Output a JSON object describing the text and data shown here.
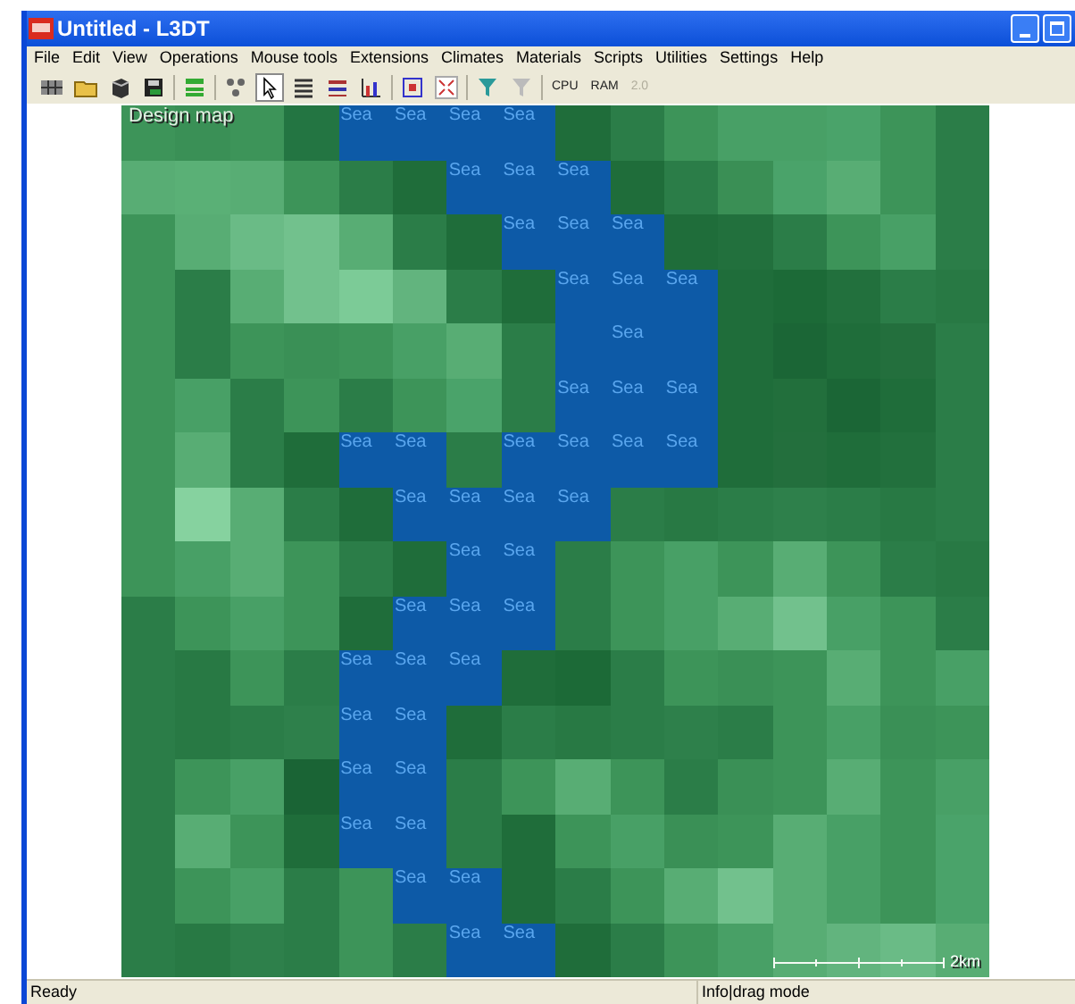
{
  "window": {
    "title": "Untitled - L3DT"
  },
  "menu": [
    {
      "label": "File"
    },
    {
      "label": "Edit"
    },
    {
      "label": "View"
    },
    {
      "label": "Operations"
    },
    {
      "label": "Mouse tools"
    },
    {
      "label": "Extensions"
    },
    {
      "label": "Climates"
    },
    {
      "label": "Materials"
    },
    {
      "label": "Scripts"
    },
    {
      "label": "Utilities"
    },
    {
      "label": "Settings"
    },
    {
      "label": "Help"
    }
  ],
  "toolbar": {
    "pointer_selected": true,
    "text_buttons": [
      {
        "label": "CPU",
        "disabled": false
      },
      {
        "label": "RAM",
        "disabled": false
      },
      {
        "label": "2.0",
        "disabled": true
      }
    ]
  },
  "map": {
    "title": "Design map",
    "scale_label": "2km",
    "rows": [
      [
        {
          "kind": "land",
          "color": "#3d9459"
        },
        {
          "kind": "land",
          "color": "#3a9056"
        },
        {
          "kind": "land",
          "color": "#3d9459"
        },
        {
          "kind": "land",
          "color": "#237542"
        },
        {
          "kind": "sea",
          "label": "Sea"
        },
        {
          "kind": "sea",
          "label": "Sea"
        },
        {
          "kind": "sea",
          "label": "Sea"
        },
        {
          "kind": "sea",
          "label": "Sea"
        },
        {
          "kind": "land",
          "color": "#1f6d3a"
        },
        {
          "kind": "land",
          "color": "#2b7d48"
        },
        {
          "kind": "land",
          "color": "#3d9459"
        },
        {
          "kind": "land",
          "color": "#48a066"
        },
        {
          "kind": "land",
          "color": "#48a066"
        },
        {
          "kind": "land",
          "color": "#4aa36a"
        },
        {
          "kind": "land",
          "color": "#3d9459"
        },
        {
          "kind": "land",
          "color": "#2b7d48"
        }
      ],
      [
        {
          "kind": "land",
          "color": "#58ad74"
        },
        {
          "kind": "land",
          "color": "#5ab076"
        },
        {
          "kind": "land",
          "color": "#58ad74"
        },
        {
          "kind": "land",
          "color": "#3d9459"
        },
        {
          "kind": "land",
          "color": "#2b7d48"
        },
        {
          "kind": "land",
          "color": "#1f6d3a"
        },
        {
          "kind": "sea",
          "label": "Sea"
        },
        {
          "kind": "sea",
          "label": "Sea"
        },
        {
          "kind": "sea",
          "label": "Sea"
        },
        {
          "kind": "land",
          "color": "#1f6d3a"
        },
        {
          "kind": "land",
          "color": "#2b7d48"
        },
        {
          "kind": "land",
          "color": "#3a8f55"
        },
        {
          "kind": "land",
          "color": "#4aa36a"
        },
        {
          "kind": "land",
          "color": "#58ad74"
        },
        {
          "kind": "land",
          "color": "#3d9459"
        },
        {
          "kind": "land",
          "color": "#2b7d48"
        }
      ],
      [
        {
          "kind": "land",
          "color": "#3d9459"
        },
        {
          "kind": "land",
          "color": "#58ad74"
        },
        {
          "kind": "land",
          "color": "#6abb86"
        },
        {
          "kind": "land",
          "color": "#72c18d"
        },
        {
          "kind": "land",
          "color": "#58ad74"
        },
        {
          "kind": "land",
          "color": "#2b7d48"
        },
        {
          "kind": "land",
          "color": "#1f6d3a"
        },
        {
          "kind": "sea",
          "label": "Sea"
        },
        {
          "kind": "sea",
          "label": "Sea"
        },
        {
          "kind": "sea",
          "label": "Sea"
        },
        {
          "kind": "land",
          "color": "#1f6d3a"
        },
        {
          "kind": "land",
          "color": "#22703d"
        },
        {
          "kind": "land",
          "color": "#2b7d48"
        },
        {
          "kind": "land",
          "color": "#3d9459"
        },
        {
          "kind": "land",
          "color": "#48a066"
        },
        {
          "kind": "land",
          "color": "#2b7d48"
        }
      ],
      [
        {
          "kind": "land",
          "color": "#3d9459"
        },
        {
          "kind": "land",
          "color": "#2b7d48"
        },
        {
          "kind": "land",
          "color": "#58ad74"
        },
        {
          "kind": "land",
          "color": "#72c18d"
        },
        {
          "kind": "land",
          "color": "#7ccb97"
        },
        {
          "kind": "land",
          "color": "#62b47e"
        },
        {
          "kind": "land",
          "color": "#2b7d48"
        },
        {
          "kind": "land",
          "color": "#1f6d3a"
        },
        {
          "kind": "sea",
          "label": "Sea"
        },
        {
          "kind": "sea",
          "label": "Sea"
        },
        {
          "kind": "sea",
          "label": "Sea"
        },
        {
          "kind": "land",
          "color": "#1f6d3a"
        },
        {
          "kind": "land",
          "color": "#1c6a37"
        },
        {
          "kind": "land",
          "color": "#22703d"
        },
        {
          "kind": "land",
          "color": "#2b7d48"
        },
        {
          "kind": "land",
          "color": "#287944"
        }
      ],
      [
        {
          "kind": "land",
          "color": "#3d9459"
        },
        {
          "kind": "land",
          "color": "#2b7d48"
        },
        {
          "kind": "land",
          "color": "#3d9459"
        },
        {
          "kind": "land",
          "color": "#3a9056"
        },
        {
          "kind": "land",
          "color": "#3d9459"
        },
        {
          "kind": "land",
          "color": "#48a066"
        },
        {
          "kind": "land",
          "color": "#58ad74"
        },
        {
          "kind": "land",
          "color": "#2b7d48"
        },
        {
          "kind": "sea"
        },
        {
          "kind": "sea",
          "label": "Sea"
        },
        {
          "kind": "sea"
        },
        {
          "kind": "land",
          "color": "#1f6d3a"
        },
        {
          "kind": "land",
          "color": "#1b6636"
        },
        {
          "kind": "land",
          "color": "#1f6d3a"
        },
        {
          "kind": "land",
          "color": "#236f3d"
        },
        {
          "kind": "land",
          "color": "#2b7d48"
        }
      ],
      [
        {
          "kind": "land",
          "color": "#3d9459"
        },
        {
          "kind": "land",
          "color": "#48a066"
        },
        {
          "kind": "land",
          "color": "#2b7d48"
        },
        {
          "kind": "land",
          "color": "#3d9459"
        },
        {
          "kind": "land",
          "color": "#2b7d48"
        },
        {
          "kind": "land",
          "color": "#3d9459"
        },
        {
          "kind": "land",
          "color": "#4aa36a"
        },
        {
          "kind": "land",
          "color": "#2b7d48"
        },
        {
          "kind": "sea",
          "label": "Sea"
        },
        {
          "kind": "sea",
          "label": "Sea"
        },
        {
          "kind": "sea",
          "label": "Sea"
        },
        {
          "kind": "land",
          "color": "#1f6d3a"
        },
        {
          "kind": "land",
          "color": "#226f3c"
        },
        {
          "kind": "land",
          "color": "#1b6636"
        },
        {
          "kind": "land",
          "color": "#1f6d3a"
        },
        {
          "kind": "land",
          "color": "#2b7d48"
        }
      ],
      [
        {
          "kind": "land",
          "color": "#3d9459"
        },
        {
          "kind": "land",
          "color": "#58ad74"
        },
        {
          "kind": "land",
          "color": "#2b7d48"
        },
        {
          "kind": "land",
          "color": "#1f6d3a"
        },
        {
          "kind": "sea",
          "label": "Sea"
        },
        {
          "kind": "sea",
          "label": "Sea"
        },
        {
          "kind": "land",
          "color": "#2b7d48"
        },
        {
          "kind": "sea",
          "label": "Sea"
        },
        {
          "kind": "sea",
          "label": "Sea"
        },
        {
          "kind": "sea",
          "label": "Sea"
        },
        {
          "kind": "sea",
          "label": "Sea"
        },
        {
          "kind": "land",
          "color": "#1f6d3a"
        },
        {
          "kind": "land",
          "color": "#236f3d"
        },
        {
          "kind": "land",
          "color": "#1f6d3a"
        },
        {
          "kind": "land",
          "color": "#22703d"
        },
        {
          "kind": "land",
          "color": "#2b7d48"
        }
      ],
      [
        {
          "kind": "land",
          "color": "#3d9459"
        },
        {
          "kind": "land",
          "color": "#86d29f"
        },
        {
          "kind": "land",
          "color": "#58ad74"
        },
        {
          "kind": "land",
          "color": "#2b7d48"
        },
        {
          "kind": "land",
          "color": "#1f6d3a"
        },
        {
          "kind": "sea",
          "label": "Sea"
        },
        {
          "kind": "sea",
          "label": "Sea"
        },
        {
          "kind": "sea",
          "label": "Sea"
        },
        {
          "kind": "sea",
          "label": "Sea"
        },
        {
          "kind": "land",
          "color": "#2b7d48"
        },
        {
          "kind": "land",
          "color": "#287944"
        },
        {
          "kind": "land",
          "color": "#2b7d48"
        },
        {
          "kind": "land",
          "color": "#2e804b"
        },
        {
          "kind": "land",
          "color": "#2b7d48"
        },
        {
          "kind": "land",
          "color": "#287944"
        },
        {
          "kind": "land",
          "color": "#2b7d48"
        }
      ],
      [
        {
          "kind": "land",
          "color": "#3d9459"
        },
        {
          "kind": "land",
          "color": "#48a066"
        },
        {
          "kind": "land",
          "color": "#58ad74"
        },
        {
          "kind": "land",
          "color": "#3d9459"
        },
        {
          "kind": "land",
          "color": "#2b7d48"
        },
        {
          "kind": "land",
          "color": "#1f6d3a"
        },
        {
          "kind": "sea",
          "label": "Sea"
        },
        {
          "kind": "sea",
          "label": "Sea"
        },
        {
          "kind": "land",
          "color": "#2b7d48"
        },
        {
          "kind": "land",
          "color": "#3d9459"
        },
        {
          "kind": "land",
          "color": "#48a066"
        },
        {
          "kind": "land",
          "color": "#3d9459"
        },
        {
          "kind": "land",
          "color": "#58ad74"
        },
        {
          "kind": "land",
          "color": "#3d9459"
        },
        {
          "kind": "land",
          "color": "#2b7d48"
        },
        {
          "kind": "land",
          "color": "#287944"
        }
      ],
      [
        {
          "kind": "land",
          "color": "#2b7d48"
        },
        {
          "kind": "land",
          "color": "#3d9459"
        },
        {
          "kind": "land",
          "color": "#48a066"
        },
        {
          "kind": "land",
          "color": "#3d9459"
        },
        {
          "kind": "land",
          "color": "#1f6d3a"
        },
        {
          "kind": "sea",
          "label": "Sea"
        },
        {
          "kind": "sea",
          "label": "Sea"
        },
        {
          "kind": "sea",
          "label": "Sea"
        },
        {
          "kind": "land",
          "color": "#2b7d48"
        },
        {
          "kind": "land",
          "color": "#3d9459"
        },
        {
          "kind": "land",
          "color": "#48a066"
        },
        {
          "kind": "land",
          "color": "#58ad74"
        },
        {
          "kind": "land",
          "color": "#72c18d"
        },
        {
          "kind": "land",
          "color": "#48a066"
        },
        {
          "kind": "land",
          "color": "#3d9459"
        },
        {
          "kind": "land",
          "color": "#2b7d48"
        }
      ],
      [
        {
          "kind": "land",
          "color": "#2b7d48"
        },
        {
          "kind": "land",
          "color": "#287944"
        },
        {
          "kind": "land",
          "color": "#3d9459"
        },
        {
          "kind": "land",
          "color": "#2b7d48"
        },
        {
          "kind": "sea",
          "label": "Sea"
        },
        {
          "kind": "sea",
          "label": "Sea"
        },
        {
          "kind": "sea",
          "label": "Sea"
        },
        {
          "kind": "land",
          "color": "#1f6d3a"
        },
        {
          "kind": "land",
          "color": "#1c6a37"
        },
        {
          "kind": "land",
          "color": "#2b7d48"
        },
        {
          "kind": "land",
          "color": "#3d9459"
        },
        {
          "kind": "land",
          "color": "#3a9056"
        },
        {
          "kind": "land",
          "color": "#3d9459"
        },
        {
          "kind": "land",
          "color": "#58ad74"
        },
        {
          "kind": "land",
          "color": "#3d9459"
        },
        {
          "kind": "land",
          "color": "#48a066"
        }
      ],
      [
        {
          "kind": "land",
          "color": "#2b7d48"
        },
        {
          "kind": "land",
          "color": "#287944"
        },
        {
          "kind": "land",
          "color": "#2b7d48"
        },
        {
          "kind": "land",
          "color": "#2e804b"
        },
        {
          "kind": "sea",
          "label": "Sea"
        },
        {
          "kind": "sea",
          "label": "Sea"
        },
        {
          "kind": "land",
          "color": "#1f6d3a"
        },
        {
          "kind": "land",
          "color": "#2b7d48"
        },
        {
          "kind": "land",
          "color": "#287944"
        },
        {
          "kind": "land",
          "color": "#2b7d48"
        },
        {
          "kind": "land",
          "color": "#2e804b"
        },
        {
          "kind": "land",
          "color": "#2b7d48"
        },
        {
          "kind": "land",
          "color": "#3d9459"
        },
        {
          "kind": "land",
          "color": "#48a066"
        },
        {
          "kind": "land",
          "color": "#3a9056"
        },
        {
          "kind": "land",
          "color": "#3d9459"
        }
      ],
      [
        {
          "kind": "land",
          "color": "#2b7d48"
        },
        {
          "kind": "land",
          "color": "#3d9459"
        },
        {
          "kind": "land",
          "color": "#48a066"
        },
        {
          "kind": "land",
          "color": "#1a6435"
        },
        {
          "kind": "sea",
          "label": "Sea"
        },
        {
          "kind": "sea",
          "label": "Sea"
        },
        {
          "kind": "land",
          "color": "#2b7d48"
        },
        {
          "kind": "land",
          "color": "#3d9459"
        },
        {
          "kind": "land",
          "color": "#58ad74"
        },
        {
          "kind": "land",
          "color": "#3d9459"
        },
        {
          "kind": "land",
          "color": "#2b7d48"
        },
        {
          "kind": "land",
          "color": "#3a9056"
        },
        {
          "kind": "land",
          "color": "#3d9459"
        },
        {
          "kind": "land",
          "color": "#58ad74"
        },
        {
          "kind": "land",
          "color": "#3d9459"
        },
        {
          "kind": "land",
          "color": "#48a066"
        }
      ],
      [
        {
          "kind": "land",
          "color": "#2b7d48"
        },
        {
          "kind": "land",
          "color": "#58ad74"
        },
        {
          "kind": "land",
          "color": "#3d9459"
        },
        {
          "kind": "land",
          "color": "#1f6d3a"
        },
        {
          "kind": "sea",
          "label": "Sea"
        },
        {
          "kind": "sea",
          "label": "Sea"
        },
        {
          "kind": "land",
          "color": "#2b7d48"
        },
        {
          "kind": "land",
          "color": "#1f6d3a"
        },
        {
          "kind": "land",
          "color": "#3d9459"
        },
        {
          "kind": "land",
          "color": "#48a066"
        },
        {
          "kind": "land",
          "color": "#3a9056"
        },
        {
          "kind": "land",
          "color": "#3d9459"
        },
        {
          "kind": "land",
          "color": "#58ad74"
        },
        {
          "kind": "land",
          "color": "#48a066"
        },
        {
          "kind": "land",
          "color": "#3d9459"
        },
        {
          "kind": "land",
          "color": "#4aa36a"
        }
      ],
      [
        {
          "kind": "land",
          "color": "#2b7d48"
        },
        {
          "kind": "land",
          "color": "#3d9459"
        },
        {
          "kind": "land",
          "color": "#48a066"
        },
        {
          "kind": "land",
          "color": "#2b7d48"
        },
        {
          "kind": "land",
          "color": "#3d9459"
        },
        {
          "kind": "sea",
          "label": "Sea"
        },
        {
          "kind": "sea",
          "label": "Sea"
        },
        {
          "kind": "land",
          "color": "#1f6d3a"
        },
        {
          "kind": "land",
          "color": "#2b7d48"
        },
        {
          "kind": "land",
          "color": "#3d9459"
        },
        {
          "kind": "land",
          "color": "#58ad74"
        },
        {
          "kind": "land",
          "color": "#72c18d"
        },
        {
          "kind": "land",
          "color": "#58ad74"
        },
        {
          "kind": "land",
          "color": "#48a066"
        },
        {
          "kind": "land",
          "color": "#3d9459"
        },
        {
          "kind": "land",
          "color": "#4aa36a"
        }
      ],
      [
        {
          "kind": "land",
          "color": "#2b7d48"
        },
        {
          "kind": "land",
          "color": "#287944"
        },
        {
          "kind": "land",
          "color": "#2e804b"
        },
        {
          "kind": "land",
          "color": "#2b7d48"
        },
        {
          "kind": "land",
          "color": "#3d9459"
        },
        {
          "kind": "land",
          "color": "#2b7d48"
        },
        {
          "kind": "sea",
          "label": "Sea"
        },
        {
          "kind": "sea",
          "label": "Sea"
        },
        {
          "kind": "land",
          "color": "#1f6d3a"
        },
        {
          "kind": "land",
          "color": "#2b7d48"
        },
        {
          "kind": "land",
          "color": "#3d9459"
        },
        {
          "kind": "land",
          "color": "#48a066"
        },
        {
          "kind": "land",
          "color": "#58ad74"
        },
        {
          "kind": "land",
          "color": "#62b47e"
        },
        {
          "kind": "land",
          "color": "#6abb86"
        },
        {
          "kind": "land",
          "color": "#58ad74"
        }
      ]
    ]
  },
  "status_bar": {
    "left": "Ready",
    "mode": "Info|drag mode"
  }
}
